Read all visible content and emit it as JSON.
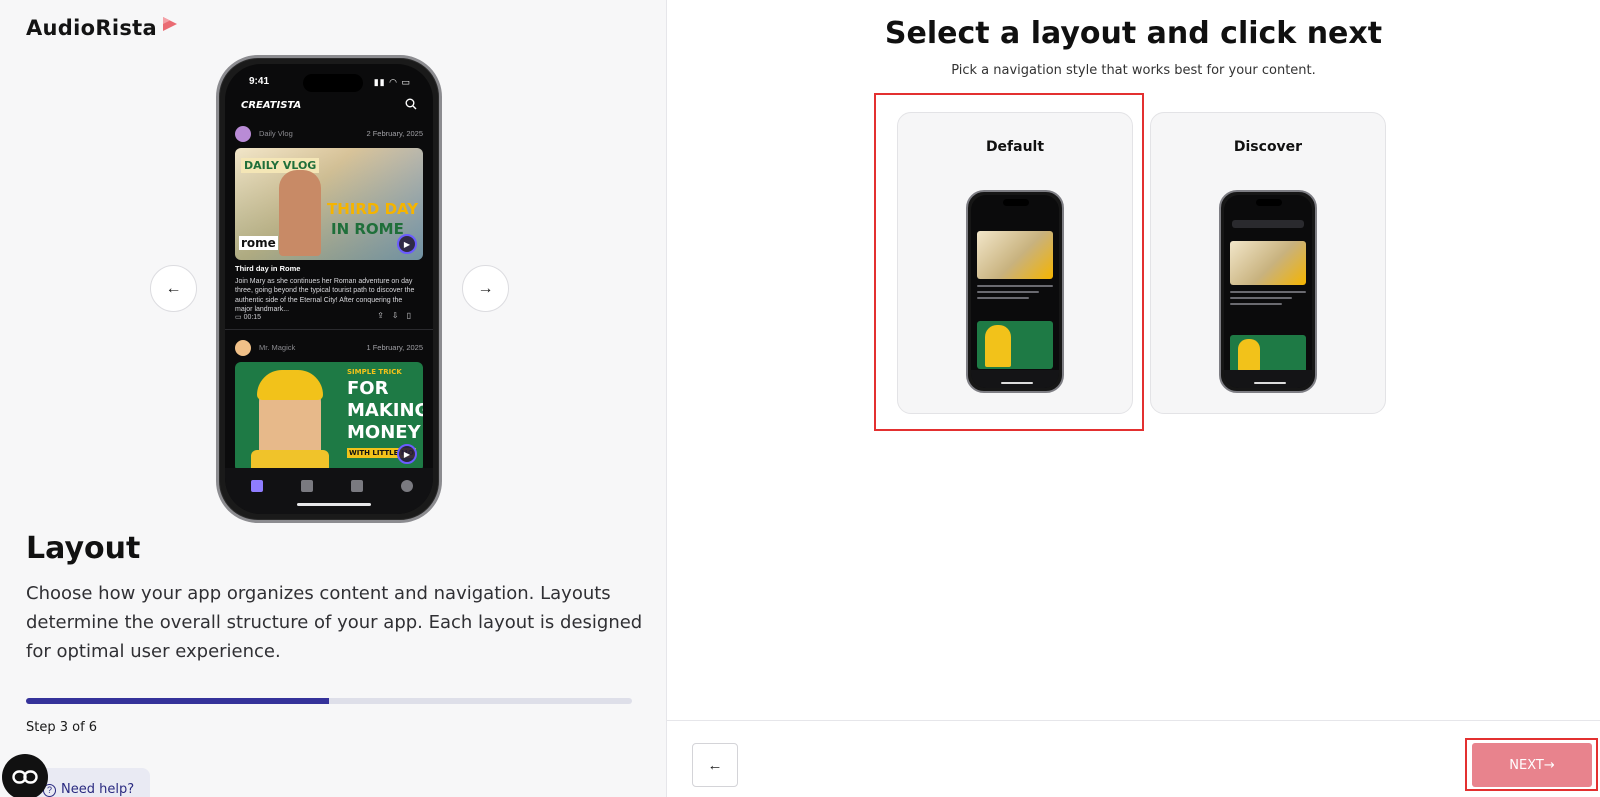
{
  "brand": {
    "name": "AudioRista"
  },
  "preview": {
    "status_time": "9:41",
    "app_brand": "CREATISTA",
    "posts": [
      {
        "author": "Daily Vlog",
        "date": "2 February, 2025",
        "thumb_text_1": "DAILY VLOG",
        "thumb_text_2": "THIRD DAY",
        "thumb_text_3": "IN ROME",
        "thumb_text_4": "rome",
        "title": "Third day in Rome",
        "description": "Join Mary as she continues her Roman adventure on day three, going beyond the typical tourist path to discover the authentic side of the Eternal City! After conquering the major landmark...",
        "duration": "00:15"
      },
      {
        "author": "Mr. Magick",
        "date": "1 February, 2025",
        "thumb_text_1": "SIMPLE TRICK",
        "thumb_text_2": "FOR",
        "thumb_text_3": "MAKING",
        "thumb_text_4": "MONEY",
        "thumb_text_5": "WITH LITTLE MO"
      }
    ]
  },
  "left": {
    "title": "Layout",
    "description": "Choose how your app organizes content and navigation. Layouts determine the overall structure of your app. Each layout is designed for optimal user experience.",
    "step_text": "Step 3 of 6",
    "progress_fraction": 0.5,
    "help_label": "Need help?"
  },
  "right": {
    "title": "Select a layout and click next",
    "subtitle": "Pick a navigation style that works best for your content.",
    "layouts": [
      {
        "label": "Default",
        "selected": true
      },
      {
        "label": "Discover",
        "selected": false
      }
    ]
  },
  "footer": {
    "back_icon": "arrow-left-icon",
    "next_label": "NEXT→"
  },
  "colors": {
    "accent": "#35329a",
    "progress_track": "#dedfe9",
    "next_button": "#e8838d",
    "selection_outline": "#e33030",
    "help_text": "#2a2a80"
  }
}
